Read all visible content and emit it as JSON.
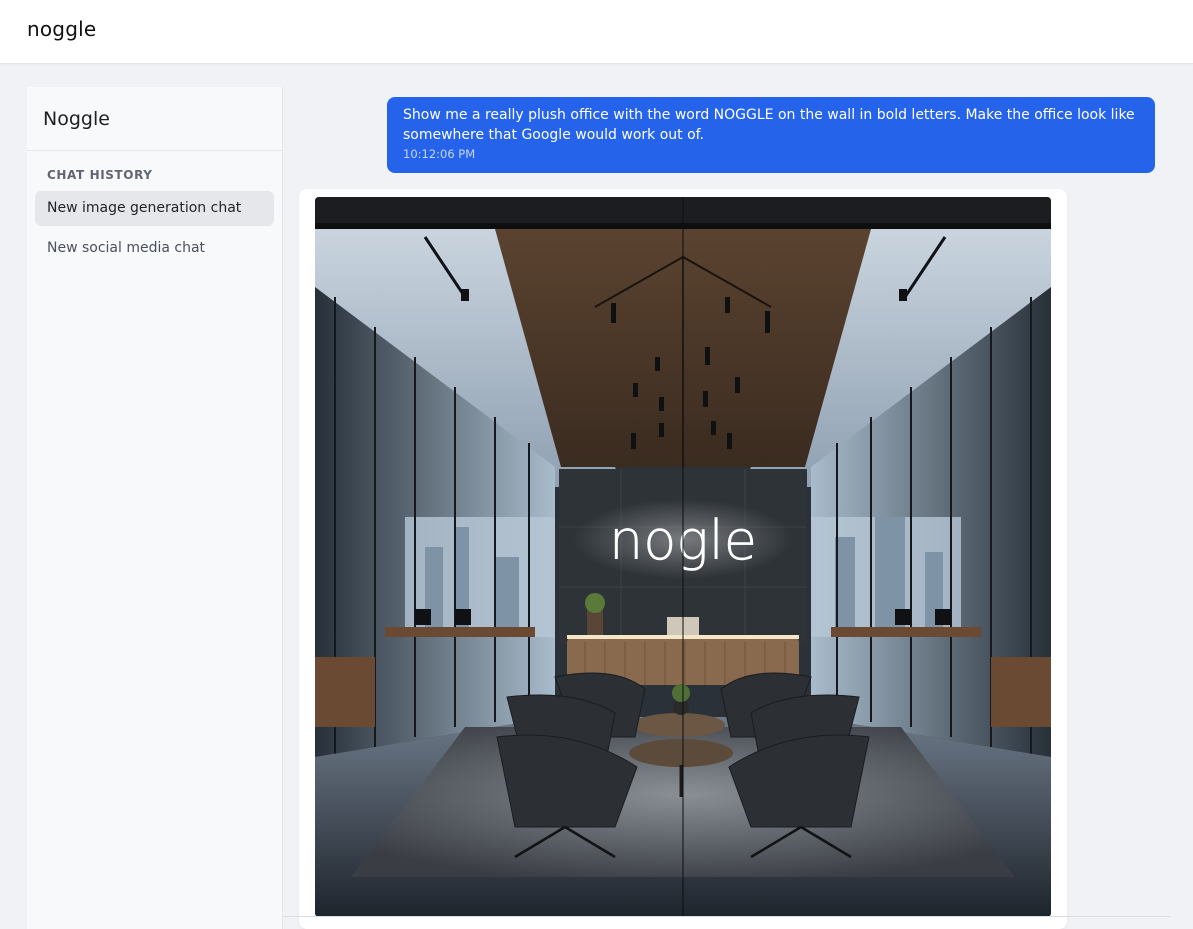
{
  "app": {
    "brand": "noggle"
  },
  "sidebar": {
    "title": "Noggle",
    "history_heading": "CHAT HISTORY",
    "items": [
      {
        "label": "New image generation chat",
        "active": true
      },
      {
        "label": "New social media chat",
        "active": false
      }
    ]
  },
  "chat": {
    "user_message": {
      "text": "Show me a really plush office with the word NOGGLE on the wall in bold letters. Make the office look like somewhere that Google would work out of.",
      "time": "10:12:06 PM"
    },
    "assistant_image": {
      "sign_text": "nogle"
    }
  },
  "colors": {
    "accent": "#2563eb",
    "sidebar_bg": "#f8f9fb",
    "active_item_bg": "#e5e7eb"
  }
}
